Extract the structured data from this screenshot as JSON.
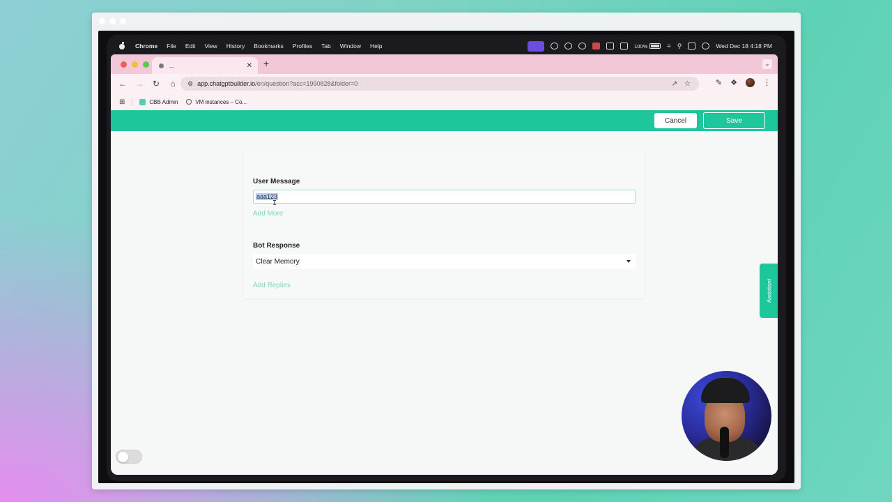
{
  "menubar": {
    "items": [
      "Chrome",
      "File",
      "Edit",
      "View",
      "History",
      "Bookmarks",
      "Profiles",
      "Tab",
      "Window",
      "Help"
    ],
    "battery": "100%",
    "clock": "Wed Dec 18  4:18 PM"
  },
  "browser": {
    "tab_title": "...",
    "url_host": "app.chatgptbuilder.io",
    "url_path": "/en/question?acc=1990828&folder=0",
    "bookmarks": [
      "CBB Admin",
      "VM instances – Co..."
    ]
  },
  "appbar": {
    "cancel_label": "Cancel",
    "save_label": "Save"
  },
  "form": {
    "user_message_label": "User Message",
    "user_message_value": "aaa123",
    "add_more_label": "Add More",
    "bot_response_label": "Bot Response",
    "bot_response_value": "Clear Memory",
    "add_replies_label": "Add Replies"
  },
  "assistant_label": "Assistant",
  "colors": {
    "accent": "#1ec79b",
    "link": "#7fd6bc",
    "tabstrip": "#f2c8d8"
  }
}
